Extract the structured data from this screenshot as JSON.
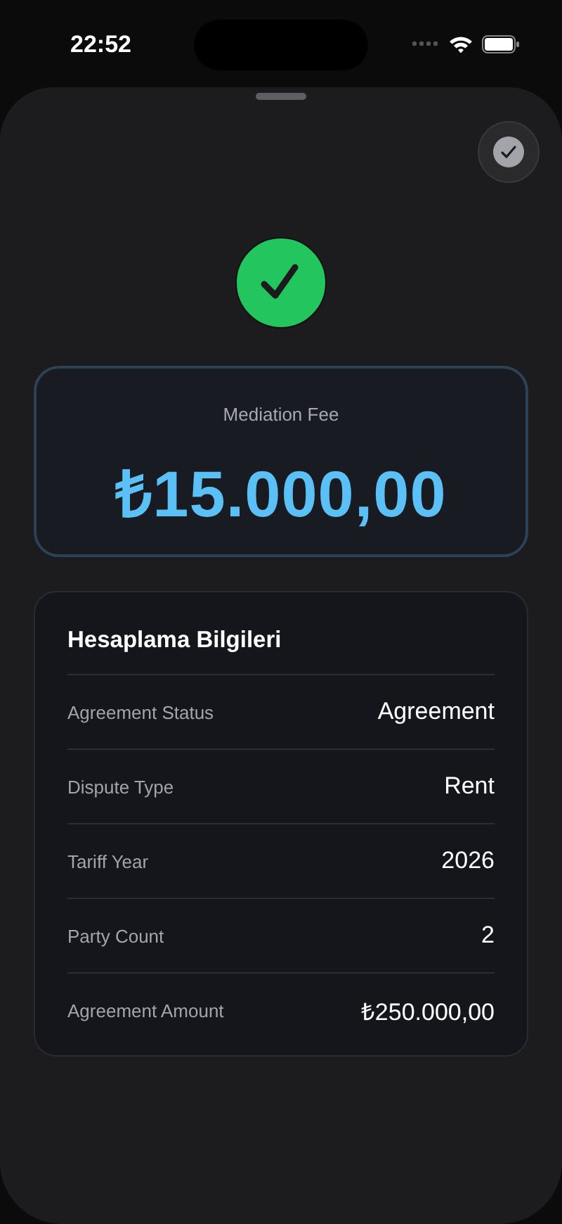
{
  "status_bar": {
    "time": "22:52"
  },
  "fee": {
    "label": "Mediation Fee",
    "amount": "₺15.000,00"
  },
  "details": {
    "title": "Hesaplama Bilgileri",
    "rows": [
      {
        "label": "Agreement Status",
        "value": "Agreement"
      },
      {
        "label": "Dispute Type",
        "value": "Rent"
      },
      {
        "label": "Tariff Year",
        "value": "2026"
      },
      {
        "label": "Party Count",
        "value": "2"
      },
      {
        "label": "Agreement Amount",
        "value": "₺250.000,00"
      }
    ]
  }
}
